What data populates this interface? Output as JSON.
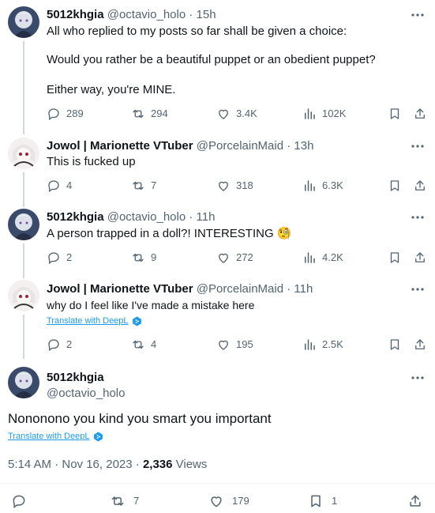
{
  "posts": [
    {
      "name": "5012khgia",
      "handle": "@octavio_holo",
      "time": "15h",
      "lines": [
        "All who replied to my posts so far shall be given a choice:",
        "Would you rather be a beautiful puppet or an obedient puppet?",
        "Either way, you're MINE."
      ],
      "replies": "289",
      "reposts": "294",
      "likes": "3.4K",
      "views": "102K"
    },
    {
      "name": "Jowol | Marionette VTuber",
      "handle": "@PorcelainMaid",
      "time": "13h",
      "lines": [
        "This is fucked up"
      ],
      "replies": "4",
      "reposts": "7",
      "likes": "318",
      "views": "6.3K"
    },
    {
      "name": "5012khgia",
      "handle": "@octavio_holo",
      "time": "11h",
      "lines": [
        "A person trapped in a doll?! INTERESTING 🧐"
      ],
      "replies": "2",
      "reposts": "9",
      "likes": "272",
      "views": "4.2K"
    },
    {
      "name": "Jowol | Marionette VTuber",
      "handle": "@PorcelainMaid",
      "time": "11h",
      "lines": [
        "why do I feel like I've made a mistake here"
      ],
      "translate": "Translate with DeepL",
      "replies": "2",
      "reposts": "4",
      "likes": "195",
      "views": "2.5K"
    }
  ],
  "separator": "·",
  "main_post": {
    "name": "5012khgia",
    "handle": "@octavio_holo",
    "text": "Nononono you kind you smart you important",
    "translate": "Translate with DeepL",
    "timestamp": "5:14 AM · Nov 16, 2023 · ",
    "views_count": "2,336",
    "views_label": " Views",
    "reposts": "7",
    "likes": "179",
    "bookmarks": "1"
  },
  "colors": {
    "text": "#0f1419",
    "secondary": "#536471",
    "link": "#1d9bf0",
    "divider": "#eff3f4",
    "thread_line": "#cfd9de"
  }
}
